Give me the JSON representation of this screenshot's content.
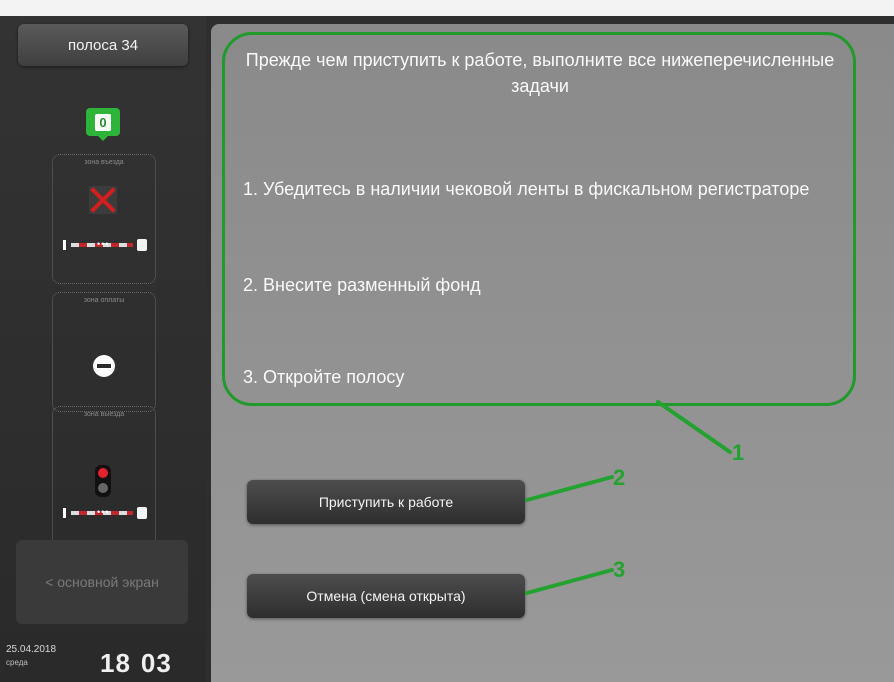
{
  "sidebar": {
    "lane_label": "полоса 34",
    "counter_value": "0",
    "zones": [
      {
        "label": "зона въезда",
        "status_icon": "x-icon"
      },
      {
        "label": "зона оплаты",
        "status_icon": "no-entry-icon"
      },
      {
        "label": "зона выезда",
        "status_icon": "traffic-light-icon"
      }
    ],
    "barrier_dots": "•••",
    "main_screen_label": "< основной экран",
    "date": "25.04.2018",
    "weekday": "среда",
    "time_hours": "18",
    "time_minutes": "03"
  },
  "main": {
    "instructions_title": "Прежде чем приступить к работе, выполните все нижеперечисленные задачи",
    "steps": [
      "1. Убедитесь в наличии чековой ленты в фискальном регистраторе",
      "2. Внесите разменный фонд",
      "3. Откройте полосу"
    ],
    "start_button_label": "Приступить к работе",
    "cancel_button_label": "Отмена (смена открыта)"
  },
  "annotations": [
    "1",
    "2",
    "3"
  ],
  "colors": {
    "accent_green": "#1f9a2b",
    "alert_red": "#d21f1f",
    "counter_green": "#2fb43a"
  }
}
